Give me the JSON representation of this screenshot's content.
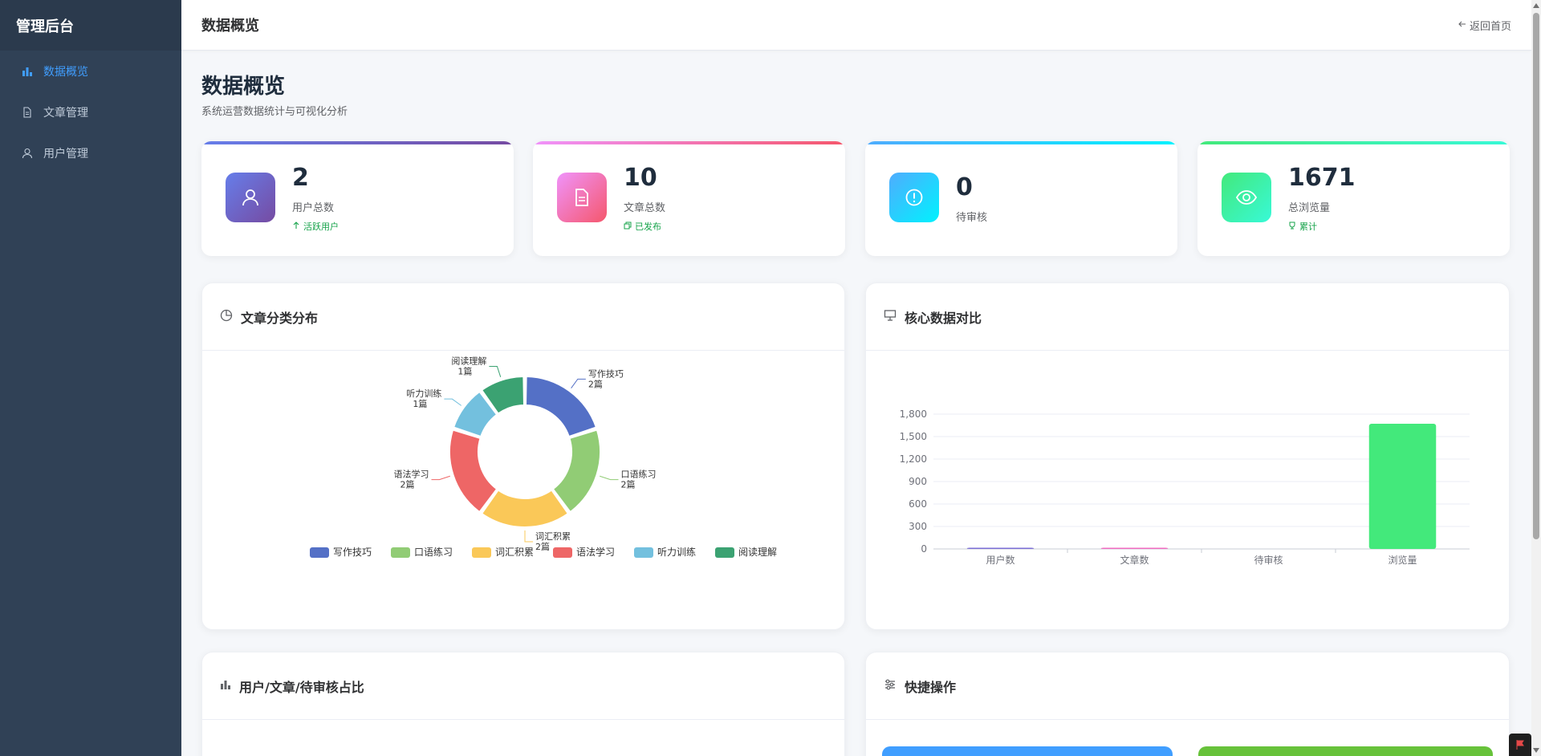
{
  "sidebar": {
    "logo": "管理后台",
    "items": [
      {
        "label": "数据概览",
        "icon": "bar-chart-icon",
        "active": true
      },
      {
        "label": "文章管理",
        "icon": "document-icon",
        "active": false
      },
      {
        "label": "用户管理",
        "icon": "user-icon",
        "active": false
      }
    ]
  },
  "header": {
    "title": "数据概览",
    "back_label": "返回首页",
    "back_icon": "arrow-left-icon"
  },
  "page": {
    "heading": "数据概览",
    "subtitle": "系统运营数据统计与可视化分析"
  },
  "stats": [
    {
      "value": "2",
      "label": "用户总数",
      "tag": "活跃用户",
      "tag_icon": "arrow-up-icon",
      "icon": "user-icon",
      "gradient": [
        "#667eea",
        "#764ba2"
      ]
    },
    {
      "value": "10",
      "label": "文章总数",
      "tag": "已发布",
      "tag_icon": "copy-icon",
      "icon": "document-icon",
      "gradient": [
        "#f093fb",
        "#f5576c"
      ]
    },
    {
      "value": "0",
      "label": "待审核",
      "tag": "",
      "icon": "warning-icon",
      "gradient": [
        "#4facfe",
        "#00f2fe"
      ]
    },
    {
      "value": "1671",
      "label": "总浏览量",
      "tag": "累计",
      "tag_icon": "trophy-icon",
      "icon": "eye-icon",
      "gradient": [
        "#43e97b",
        "#38f9d7"
      ]
    }
  ],
  "panels": {
    "category": {
      "title": "文章分类分布",
      "icon": "pie-chart-icon"
    },
    "compare": {
      "title": "核心数据对比",
      "icon": "presentation-icon"
    },
    "ratio": {
      "title": "用户/文章/待审核占比",
      "icon": "bar-chart-icon"
    },
    "quick": {
      "title": "快捷操作",
      "icon": "sliders-icon"
    }
  },
  "chart_data": [
    {
      "type": "pie",
      "variant": "donut",
      "unit": "篇",
      "slices": [
        {
          "name": "写作技巧",
          "value": 2,
          "label": "2篇",
          "color": "#5470c6"
        },
        {
          "name": "口语练习",
          "value": 2,
          "label": "2篇",
          "color": "#91cc75"
        },
        {
          "name": "词汇积累",
          "value": 2,
          "label": "2篇",
          "color": "#fac858"
        },
        {
          "name": "语法学习",
          "value": 2,
          "label": "2篇",
          "color": "#ee6666"
        },
        {
          "name": "听力训练",
          "value": 1,
          "label": "1篇",
          "color": "#73c0de"
        },
        {
          "name": "阅读理解",
          "value": 1,
          "label": "1篇",
          "color": "#3ba272"
        }
      ],
      "legend_position": "bottom"
    },
    {
      "type": "bar",
      "categories": [
        "用户数",
        "文章数",
        "待审核",
        "浏览量"
      ],
      "values": [
        2,
        10,
        0,
        1671
      ],
      "colors": [
        "#7c6fd6",
        "#f06cc1",
        "#4facfe",
        "#43e97b"
      ],
      "y_ticks": [
        "0",
        "300",
        "600",
        "900",
        "1,200",
        "1,500",
        "1,800"
      ],
      "ylim": [
        0,
        1800
      ],
      "grid": true
    }
  ],
  "quick_actions": {
    "colors": [
      "#409eff",
      "#67c23a"
    ]
  }
}
